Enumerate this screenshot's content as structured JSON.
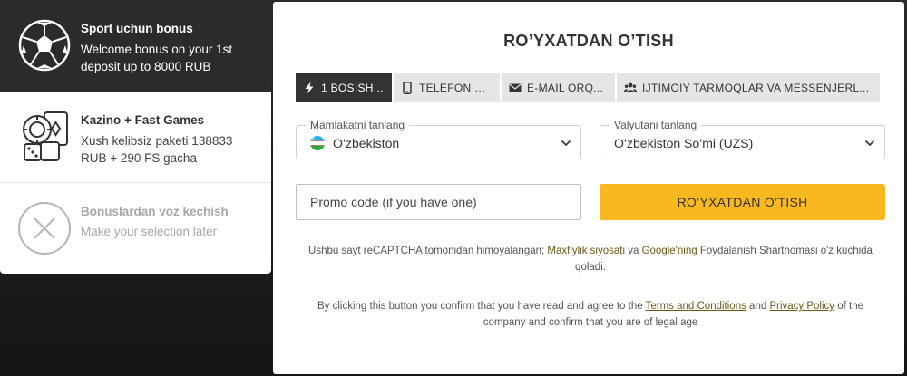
{
  "bonuses": {
    "sport": {
      "title": "Sport uchun bonus",
      "description": "Welcome bonus on your 1st deposit up to 8000 RUB",
      "icon": "soccer-ball-icon"
    },
    "casino": {
      "title": "Kazino + Fast Games",
      "description": "Xush kelibsiz paketi 138833 RUB + 290 FS gacha",
      "icon": "casino-chips-cards-icon"
    },
    "none": {
      "title": "Bonuslardan voz kechish",
      "description": "Make your selection later",
      "icon": "close-circle-icon"
    }
  },
  "registration": {
    "title": "RO’YXATDAN O’TISH",
    "tabs": [
      {
        "label": "1 BOSISH...",
        "icon": "lightning-icon",
        "active": true
      },
      {
        "label": "TELEFON BIL...",
        "icon": "phone-icon",
        "active": false
      },
      {
        "label": "E-MAIL ORQ...",
        "icon": "envelope-icon",
        "active": false
      },
      {
        "label": "IJTIMOIY TARMOQLAR VA MESSENJERL...",
        "icon": "people-icon",
        "active": false
      }
    ],
    "country": {
      "legend": "Mamlakatni tanlang",
      "value": "O‘zbekiston",
      "icon": "uzbekistan-flag-icon"
    },
    "currency": {
      "legend": "Valyutani tanlang",
      "value": "O‘zbekiston So‘mi (UZS)"
    },
    "promo": {
      "placeholder": "Promo code (if you have one)"
    },
    "submit_label": "RO’YXATDAN O’TISH",
    "recaptcha_note": {
      "part1": "Ushbu sayt reCAPTCHA tomonidan himoyalangan; ",
      "privacy_link": "Maxfiylik siyosati",
      "part2": " va ",
      "google_link": "Google'ning ",
      "part3": "Foydalanish Shartnomasi o'z kuchida qoladi."
    },
    "terms_note": {
      "part1": "By clicking this button you confirm that you have read and agree to the ",
      "terms_link": "Terms and Conditions",
      "part2": " and ",
      "privacy_link": "Privacy Policy",
      "part3": " of the company and confirm that you are of legal age"
    }
  },
  "colors": {
    "accent": "#f9b820",
    "dark_panel": "#2b2b2b",
    "link": "#6b5a1a"
  }
}
